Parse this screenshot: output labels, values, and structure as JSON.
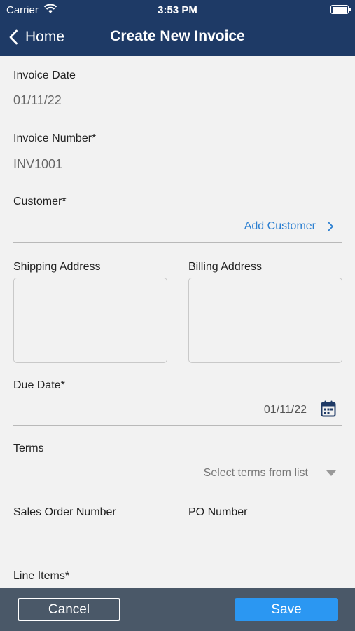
{
  "status_bar": {
    "carrier": "Carrier",
    "time": "3:53 PM"
  },
  "nav": {
    "back_label": "Home",
    "title": "Create New Invoice"
  },
  "form": {
    "invoice_date": {
      "label": "Invoice Date",
      "value": "01/11/22"
    },
    "invoice_number": {
      "label": "Invoice Number*",
      "value": "INV1001"
    },
    "customer": {
      "label": "Customer*",
      "add_link": "Add Customer"
    },
    "shipping_address": {
      "label": "Shipping Address"
    },
    "billing_address": {
      "label": "Billing Address"
    },
    "due_date": {
      "label": "Due Date*",
      "value": "01/11/22"
    },
    "terms": {
      "label": "Terms",
      "placeholder": "Select terms from list"
    },
    "sales_order_number": {
      "label": "Sales Order Number"
    },
    "po_number": {
      "label": "PO Number"
    },
    "line_items": {
      "label": "Line Items*"
    }
  },
  "actions": {
    "cancel_label": "Cancel",
    "save_label": "Save"
  },
  "colors": {
    "navbar": "#1e3a66",
    "link": "#2b7fd1",
    "save": "#2b97f2",
    "bottom_bar": "#4a5868"
  }
}
